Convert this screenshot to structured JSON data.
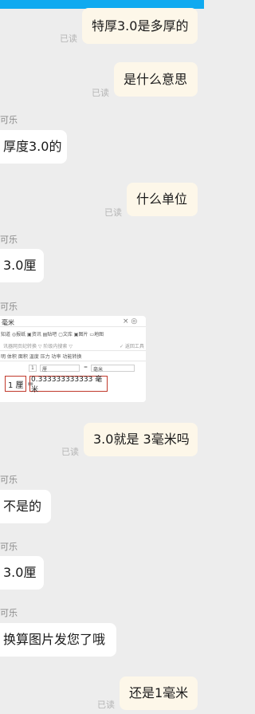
{
  "colors": {
    "top_bar": "#10aaf0",
    "my_bubble": "#fdf7e9",
    "their_bubble": "#ffffff",
    "background": "#ededed"
  },
  "read_label": "已读",
  "sender_label": "可乐",
  "messages": [
    {
      "from": "me",
      "text": "特厚3.0是多厚的",
      "read": true
    },
    {
      "from": "me",
      "text": "是什么意思",
      "read": true
    },
    {
      "from": "other",
      "text": "厚度3.0的"
    },
    {
      "from": "me",
      "text": "什么单位",
      "read": true
    },
    {
      "from": "other",
      "text": "3.0厘"
    },
    {
      "from": "other",
      "image": true
    },
    {
      "from": "me",
      "text": "3.0就是 3毫米吗",
      "read": true
    },
    {
      "from": "other",
      "text": "不是的"
    },
    {
      "from": "other",
      "text": "3.0厘"
    },
    {
      "from": "other",
      "text": "换算图片发您了哦"
    },
    {
      "from": "me",
      "text": "还是1毫米",
      "read": true
    }
  ],
  "image_message": {
    "title": "毫米",
    "tabs_row": "知道  ◎报纸  ▣资讯  ▤贴吧  ▢文库  ▣图片  ▭地图",
    "sub_row": "讯器网页纪转换 ▽  阶级内搜索 ▽",
    "sub_right": "✓ 返回工具",
    "units_row": "明   体积   面积   温度   压力   功率   功能转换",
    "input_value": "1",
    "from_unit": "厘",
    "equals": "=",
    "to_unit": "毫米",
    "result_left": "1 厘",
    "result_right": "0.333333333333 毫米"
  }
}
